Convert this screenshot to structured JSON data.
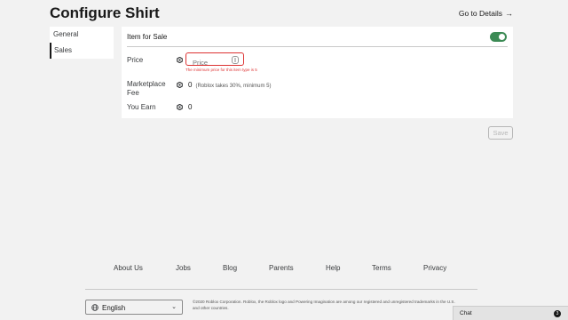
{
  "header": {
    "title": "Configure Shirt",
    "goto_label": "Go to Details"
  },
  "sidenav": {
    "items": [
      {
        "label": "General"
      },
      {
        "label": "Sales"
      }
    ]
  },
  "sales": {
    "item_for_sale_label": "Item for Sale",
    "item_for_sale_on": true,
    "price_label": "Price",
    "price_placeholder": "Price",
    "price_error": "The minimum price for this item type is 5",
    "marketplace_fee_label": "Marketplace Fee",
    "marketplace_fee_value": "0",
    "marketplace_fee_note": "(Roblox takes 30%, minimum 5)",
    "you_earn_label": "You Earn",
    "you_earn_value": "0",
    "save_label": "Save"
  },
  "footer": {
    "links": [
      "About Us",
      "Jobs",
      "Blog",
      "Parents",
      "Help",
      "Terms",
      "Privacy"
    ],
    "language": "English",
    "copyright": "©2020 Roblox Corporation. Roblox, the Roblox logo and Powering Imagination are among our registered and unregistered trademarks in the U.S. and other countries."
  },
  "chat": {
    "label": "Chat",
    "badge": "3"
  },
  "colors": {
    "toggle_on": "#3b8a54",
    "error": "#dd3333"
  }
}
